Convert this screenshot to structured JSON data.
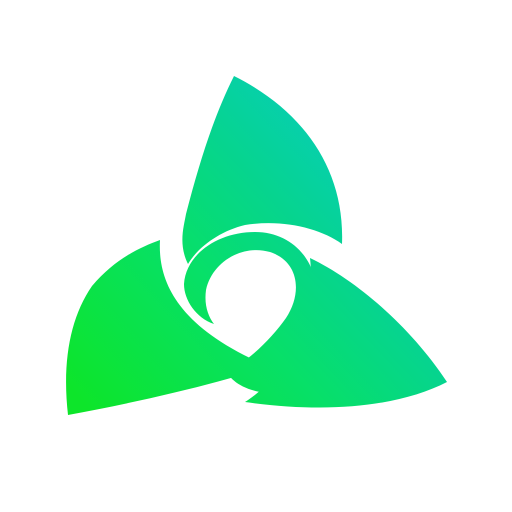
{
  "logo": {
    "icon": "triskelion-sail-logo-icon",
    "colors": {
      "cyan": "#08cad2",
      "teal": "#06d48f",
      "green": "#07e067",
      "lime": "#0de52a",
      "background": "#ffffff"
    }
  }
}
